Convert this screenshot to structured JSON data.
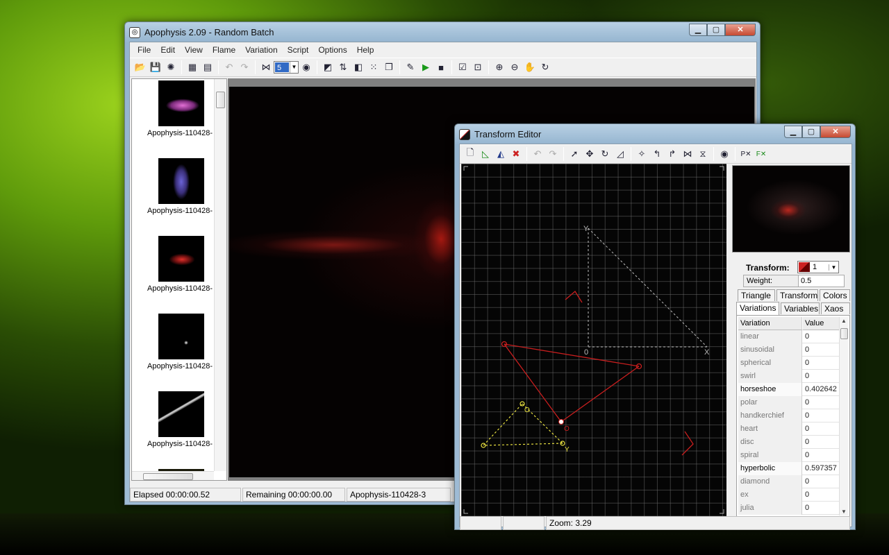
{
  "main_window": {
    "title": "Apophysis 2.09 - Random Batch",
    "menu": [
      "File",
      "Edit",
      "View",
      "Flame",
      "Variation",
      "Script",
      "Options",
      "Help"
    ],
    "batch_size": "5",
    "thumbnails": [
      "Apophysis-110428-",
      "Apophysis-110428-",
      "Apophysis-110428-",
      "Apophysis-110428-",
      "Apophysis-110428-"
    ],
    "status": {
      "elapsed": "Elapsed 00:00:00.52",
      "remaining": "Remaining 00:00:00.00",
      "name": "Apophysis-110428-3"
    }
  },
  "editor": {
    "title": "Transform Editor",
    "transform_label": "Transform:",
    "transform_value": "1",
    "weight_label": "Weight:",
    "weight_value": "0.5",
    "tabs_row1": [
      "Triangle",
      "Transform",
      "Colors"
    ],
    "tabs_row2": [
      "Variations",
      "Variables",
      "Xaos"
    ],
    "table_headers": [
      "Variation",
      "Value"
    ],
    "variations": [
      {
        "name": "linear",
        "value": "0"
      },
      {
        "name": "sinusoidal",
        "value": "0"
      },
      {
        "name": "spherical",
        "value": "0"
      },
      {
        "name": "swirl",
        "value": "0"
      },
      {
        "name": "horseshoe",
        "value": "0.402642"
      },
      {
        "name": "polar",
        "value": "0"
      },
      {
        "name": "handkerchief",
        "value": "0"
      },
      {
        "name": "heart",
        "value": "0"
      },
      {
        "name": "disc",
        "value": "0"
      },
      {
        "name": "spiral",
        "value": "0"
      },
      {
        "name": "hyperbolic",
        "value": "0.597357"
      },
      {
        "name": "diamond",
        "value": "0"
      },
      {
        "name": "ex",
        "value": "0"
      },
      {
        "name": "julia",
        "value": "0"
      }
    ],
    "canvas_labels": {
      "y": "Y",
      "x": "X",
      "origin": "0",
      "red_o": "O",
      "yellow_o": "O",
      "yellow_y": "Y"
    },
    "zoom": "Zoom: 3.29",
    "transform_color": "#cc2020"
  }
}
